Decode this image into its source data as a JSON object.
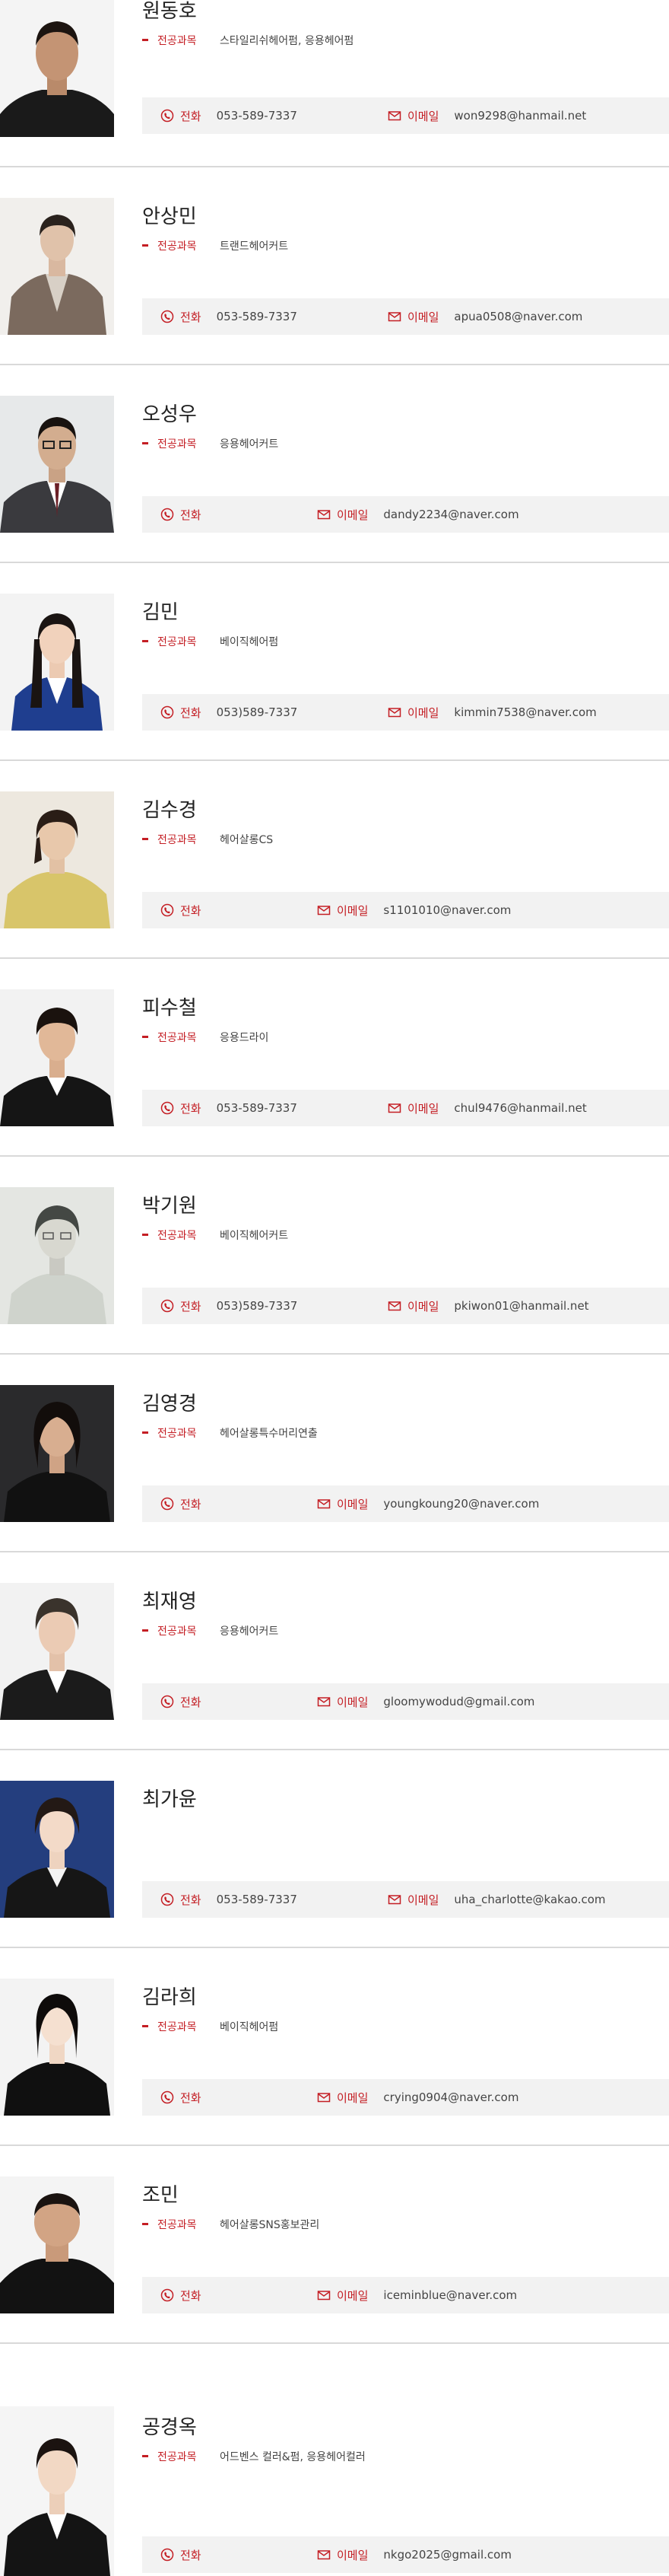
{
  "labels": {
    "major": "전공과목",
    "phone": "전화",
    "email": "이메일"
  },
  "colors": {
    "accent": "#c41e24",
    "contact_bg": "#f2f2f2",
    "divider": "#d9d9d9"
  },
  "icons": {
    "phone": "phone-icon",
    "email": "envelope-icon"
  },
  "faculty": [
    {
      "name": "원동호",
      "major": "스타일리쉬헤어펌, 응용헤어펌",
      "phone": "053-589-7337",
      "email": "won9298@hanmail.net"
    },
    {
      "name": "안상민",
      "major": "트랜드헤어커트",
      "phone": "053-589-7337",
      "email": "apua0508@naver.com"
    },
    {
      "name": "오성우",
      "major": "응용헤어커트",
      "phone": "",
      "email": "dandy2234@naver.com"
    },
    {
      "name": "김민",
      "major": "베이직헤어펌",
      "phone": "053)589-7337",
      "email": "kimmin7538@naver.com"
    },
    {
      "name": "김수경",
      "major": "헤어살롱CS",
      "phone": "",
      "email": "s1101010@naver.com"
    },
    {
      "name": "피수철",
      "major": "응용드라이",
      "phone": "053-589-7337",
      "email": "chul9476@hanmail.net"
    },
    {
      "name": "박기원",
      "major": "베이직헤어커트",
      "phone": "053)589-7337",
      "email": "pkiwon01@hanmail.net"
    },
    {
      "name": "김영경",
      "major": "헤어살롱특수머리연출",
      "phone": "",
      "email": "youngkoung20@naver.com"
    },
    {
      "name": "최재영",
      "major": "응용헤어커트",
      "phone": "",
      "email": "gloomywodud@gmail.com"
    },
    {
      "name": "최가윤",
      "major": "",
      "phone": "053-589-7337",
      "email": "uha_charlotte@kakao.com"
    },
    {
      "name": "김라희",
      "major": "베이직헤어펌",
      "phone": "",
      "email": "crying0904@naver.com"
    },
    {
      "name": "조민",
      "major": "헤어살롱SNS홍보관리",
      "phone": "",
      "email": "iceminblue@naver.com"
    },
    {
      "name": "공경옥",
      "major": "어드벤스 컬러&펌, 응용헤어컬러",
      "phone": "",
      "email": "nkgo2025@gmail.com"
    }
  ]
}
